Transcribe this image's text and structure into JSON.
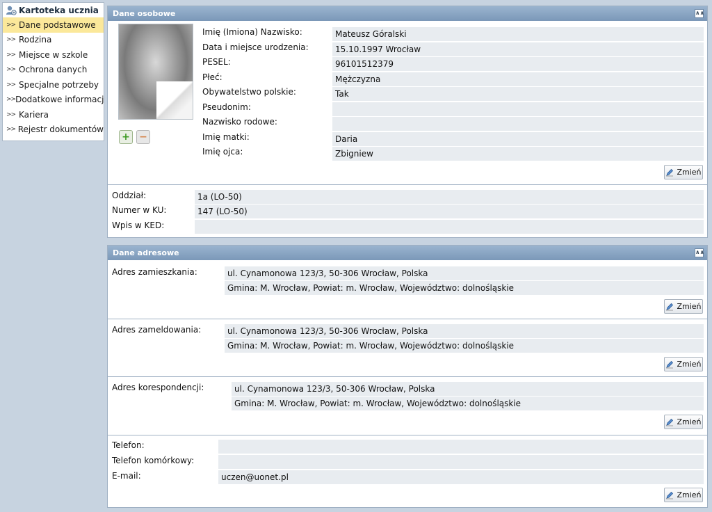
{
  "sidebar": {
    "title": "Kartoteka ucznia",
    "items": [
      {
        "label": "Dane podstawowe"
      },
      {
        "label": "Rodzina"
      },
      {
        "label": "Miejsce w szkole"
      },
      {
        "label": "Ochrona danych"
      },
      {
        "label": "Specjalne potrzeby"
      },
      {
        "label": "Dodatkowe informacje"
      },
      {
        "label": "Kariera"
      },
      {
        "label": "Rejestr dokumentów"
      }
    ]
  },
  "personal": {
    "title": "Dane osobowe",
    "fields": [
      {
        "label": "Imię (Imiona) Nazwisko:",
        "value": "Mateusz Góralski"
      },
      {
        "label": "Data i miejsce urodzenia:",
        "value": "15.10.1997 Wrocław"
      },
      {
        "label": "PESEL:",
        "value": "96101512379"
      },
      {
        "label": "Płeć:",
        "value": "Mężczyzna"
      },
      {
        "label": "Obywatelstwo polskie:",
        "value": "Tak"
      },
      {
        "label": "Pseudonim:",
        "value": ""
      },
      {
        "label": "Nazwisko rodowe:",
        "value": ""
      },
      {
        "label": "Imię matki:",
        "value": "Daria"
      },
      {
        "label": "Imię ojca:",
        "value": "Zbigniew"
      }
    ],
    "school": [
      {
        "label": "Oddział:",
        "value": "1a (LO-50)"
      },
      {
        "label": "Numer w KU:",
        "value": "147 (LO-50)"
      },
      {
        "label": "Wpis w KED:",
        "value": ""
      }
    ],
    "change_label": "Zmień"
  },
  "address": {
    "title": "Dane adresowe",
    "blocks": [
      {
        "label": "Adres zamieszkania:",
        "line1": "ul. Cynamonowa 123/3, 50-306 Wrocław, Polska",
        "line2": "Gmina: M. Wrocław, Powiat: m. Wrocław, Województwo: dolnośląskie"
      },
      {
        "label": "Adres zameldowania:",
        "line1": "ul. Cynamonowa 123/3, 50-306 Wrocław, Polska",
        "line2": "Gmina: M. Wrocław, Powiat: m. Wrocław, Województwo: dolnośląskie"
      },
      {
        "label": "Adres korespondencji:",
        "line1": "ul. Cynamonowa 123/3, 50-306 Wrocław, Polska",
        "line2": "Gmina: M. Wrocław, Powiat: m. Wrocław, Województwo: dolnośląskie"
      }
    ],
    "contact": [
      {
        "label": "Telefon:",
        "value": ""
      },
      {
        "label": "Telefon komórkowy:",
        "value": ""
      },
      {
        "label": "E-mail:",
        "value": "uczen@uonet.pl"
      }
    ],
    "change_label": "Zmień"
  },
  "icons": {
    "user": "user-icon",
    "add": "plus-icon",
    "remove": "minus-icon",
    "edit": "pencil-icon",
    "collapse": "collapse-up-icon"
  }
}
